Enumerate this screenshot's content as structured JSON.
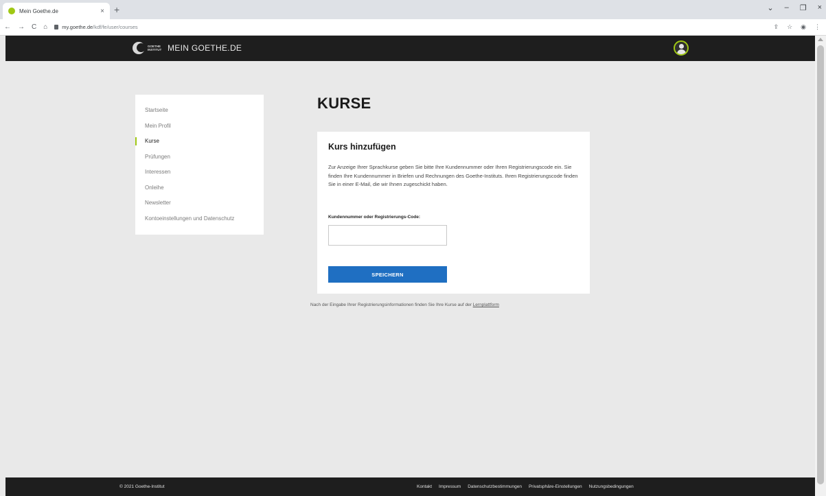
{
  "browser": {
    "tab_title": "Mein Goethe.de",
    "tab_close": "×",
    "new_tab": "+",
    "url_host": "my.goethe.de",
    "url_path": "/kdf/fe/user/courses",
    "nav": {
      "back": "←",
      "forward": "→",
      "reload": "C",
      "home": "⌂"
    },
    "window": {
      "chevron": "⌄",
      "minimize": "–",
      "restore": "❐",
      "close": "×"
    },
    "toolbar": {
      "share": "⇪",
      "bookmark": "☆",
      "profile": "◉",
      "menu": "⋮"
    }
  },
  "header": {
    "logo_text": "GOETHE INSTITUT",
    "site_title": "MEIN GOETHE.DE"
  },
  "sidebar": {
    "items": [
      {
        "label": "Startseite",
        "active": false
      },
      {
        "label": "Mein Profil",
        "active": false
      },
      {
        "label": "Kurse",
        "active": true
      },
      {
        "label": "Prüfungen",
        "active": false
      },
      {
        "label": "Interessen",
        "active": false
      },
      {
        "label": "Onleihe",
        "active": false
      },
      {
        "label": "Newsletter",
        "active": false
      },
      {
        "label": "Kontoeinstellungen und Datenschutz",
        "active": false
      }
    ]
  },
  "main": {
    "page_title": "KURSE",
    "card_title": "Kurs hinzufügen",
    "card_text": "Zur Anzeige Ihrer Sprachkurse geben Sie bitte Ihre Kundennummer oder Ihren Registrierungscode ein. Sie finden Ihre Kundennummer in Briefen und Rechnungen des Goethe-Instituts. Ihren Registrierungscode finden Sie in einer E-Mail, die wir Ihnen zugeschickt haben.",
    "field_label": "Kundennummer oder Registrierungs-Code:",
    "field_value": "",
    "save_label": "SPEICHERN",
    "note_text": "Nach der Eingabe Ihrer Registrierungsinformationen finden Sie Ihre Kurse auf der ",
    "note_link": "Lernplattform"
  },
  "footer": {
    "copyright": "© 2021 Goethe-Institut",
    "links": [
      "Kontakt",
      "Impressum",
      "Datenschutzbestimmungen",
      "Privatsphäre-Einstellungen",
      "Nutzungsbedingungen"
    ]
  },
  "colors": {
    "accent_green": "#a0c814",
    "button_blue": "#1f6fc2",
    "header_dark": "#1e1e1e",
    "page_bg": "#e9e9e9"
  }
}
